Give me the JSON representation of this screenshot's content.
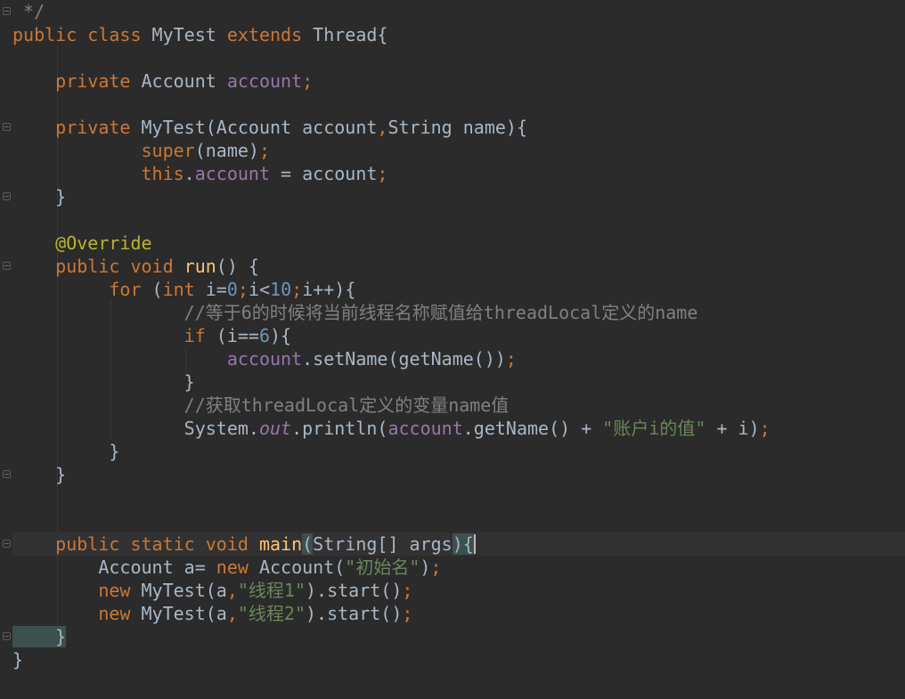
{
  "editor": {
    "language": "java",
    "colors": {
      "background": "#2b2b2b",
      "current_line": "#323232",
      "default": "#a9b7c6",
      "keyword": "#cc7832",
      "field": "#9876aa",
      "number": "#6897bb",
      "string": "#6a8759",
      "comment": "#808080",
      "annotation": "#bbb529",
      "method_decl": "#ffc66d",
      "brace_match": "#3b514d"
    },
    "lines": [
      [
        {
          "text": " */",
          "cls": "comment"
        }
      ],
      [
        {
          "text": "public class ",
          "cls": "keyword"
        },
        {
          "text": "MyTest ",
          "cls": "default"
        },
        {
          "text": "extends ",
          "cls": "keyword"
        },
        {
          "text": "Thread{",
          "cls": "default"
        }
      ],
      [],
      [
        {
          "text": "    private ",
          "cls": "keyword"
        },
        {
          "text": "Account ",
          "cls": "default"
        },
        {
          "text": "account",
          "cls": "field"
        },
        {
          "text": ";",
          "cls": "keyword"
        }
      ],
      [],
      [
        {
          "text": "    private ",
          "cls": "keyword"
        },
        {
          "text": "MyTest(Account account",
          "cls": "default"
        },
        {
          "text": ",",
          "cls": "keyword"
        },
        {
          "text": "String name){",
          "cls": "default"
        }
      ],
      [
        {
          "text": "            super",
          "cls": "keyword"
        },
        {
          "text": "(name)",
          "cls": "default"
        },
        {
          "text": ";",
          "cls": "keyword"
        }
      ],
      [
        {
          "text": "            this",
          "cls": "keyword"
        },
        {
          "text": ".",
          "cls": "default"
        },
        {
          "text": "account",
          "cls": "field"
        },
        {
          "text": " = account",
          "cls": "default"
        },
        {
          "text": ";",
          "cls": "keyword"
        }
      ],
      [
        {
          "text": "    }",
          "cls": "default"
        }
      ],
      [],
      [
        {
          "text": "    @Override",
          "cls": "annotation"
        }
      ],
      [
        {
          "text": "    public void ",
          "cls": "keyword"
        },
        {
          "text": "run",
          "cls": "method_decl"
        },
        {
          "text": "() {",
          "cls": "default"
        }
      ],
      [
        {
          "text": "         for ",
          "cls": "keyword"
        },
        {
          "text": "(",
          "cls": "default"
        },
        {
          "text": "int ",
          "cls": "keyword"
        },
        {
          "text": "i=",
          "cls": "default"
        },
        {
          "text": "0",
          "cls": "number"
        },
        {
          "text": ";",
          "cls": "keyword"
        },
        {
          "text": "i<",
          "cls": "default"
        },
        {
          "text": "10",
          "cls": "number"
        },
        {
          "text": ";",
          "cls": "keyword"
        },
        {
          "text": "i++){",
          "cls": "default"
        }
      ],
      [
        {
          "text": "                //等于6的时候将当前线程名称赋值给threadLocal定义的name",
          "cls": "comment"
        }
      ],
      [
        {
          "text": "                if ",
          "cls": "keyword"
        },
        {
          "text": "(i==",
          "cls": "default"
        },
        {
          "text": "6",
          "cls": "number"
        },
        {
          "text": "){",
          "cls": "default"
        }
      ],
      [
        {
          "text": "                    ",
          "cls": "default"
        },
        {
          "text": "account",
          "cls": "field"
        },
        {
          "text": ".setName(getName())",
          "cls": "default"
        },
        {
          "text": ";",
          "cls": "keyword"
        }
      ],
      [
        {
          "text": "                }",
          "cls": "default"
        }
      ],
      [
        {
          "text": "                //获取threadLocal定义的变量name值",
          "cls": "comment"
        }
      ],
      [
        {
          "text": "                System.",
          "cls": "default"
        },
        {
          "text": "out",
          "cls": "field_italic"
        },
        {
          "text": ".println(",
          "cls": "default"
        },
        {
          "text": "account",
          "cls": "field"
        },
        {
          "text": ".getName() + ",
          "cls": "default"
        },
        {
          "text": "\"账户i的值\"",
          "cls": "string"
        },
        {
          "text": " + i)",
          "cls": "default"
        },
        {
          "text": ";",
          "cls": "keyword"
        }
      ],
      [
        {
          "text": "         }",
          "cls": "default"
        }
      ],
      [
        {
          "text": "    }",
          "cls": "default"
        }
      ],
      [],
      [],
      [
        {
          "text": "    public static void ",
          "cls": "keyword"
        },
        {
          "text": "main",
          "cls": "method_decl"
        },
        {
          "text": "(",
          "cls": "match"
        },
        {
          "text": "String[] args",
          "cls": "default"
        },
        {
          "text": "){",
          "cls": "match"
        }
      ],
      [
        {
          "text": "        Account a= ",
          "cls": "default"
        },
        {
          "text": "new ",
          "cls": "keyword"
        },
        {
          "text": "Account(",
          "cls": "default"
        },
        {
          "text": "\"初始名\"",
          "cls": "string"
        },
        {
          "text": ")",
          "cls": "default"
        },
        {
          "text": ";",
          "cls": "keyword"
        }
      ],
      [
        {
          "text": "        new ",
          "cls": "keyword"
        },
        {
          "text": "MyTest(a",
          "cls": "default"
        },
        {
          "text": ",",
          "cls": "keyword"
        },
        {
          "text": "\"线程1\"",
          "cls": "string"
        },
        {
          "text": ").start()",
          "cls": "default"
        },
        {
          "text": ";",
          "cls": "keyword"
        }
      ],
      [
        {
          "text": "        new ",
          "cls": "keyword"
        },
        {
          "text": "MyTest(a",
          "cls": "default"
        },
        {
          "text": ",",
          "cls": "keyword"
        },
        {
          "text": "\"线程2\"",
          "cls": "string"
        },
        {
          "text": ").start()",
          "cls": "default"
        },
        {
          "text": ";",
          "cls": "keyword"
        }
      ],
      [
        {
          "text": "    }",
          "cls": "match"
        }
      ],
      [
        {
          "text": "}",
          "cls": "default"
        }
      ]
    ],
    "current_line_index": 23
  }
}
